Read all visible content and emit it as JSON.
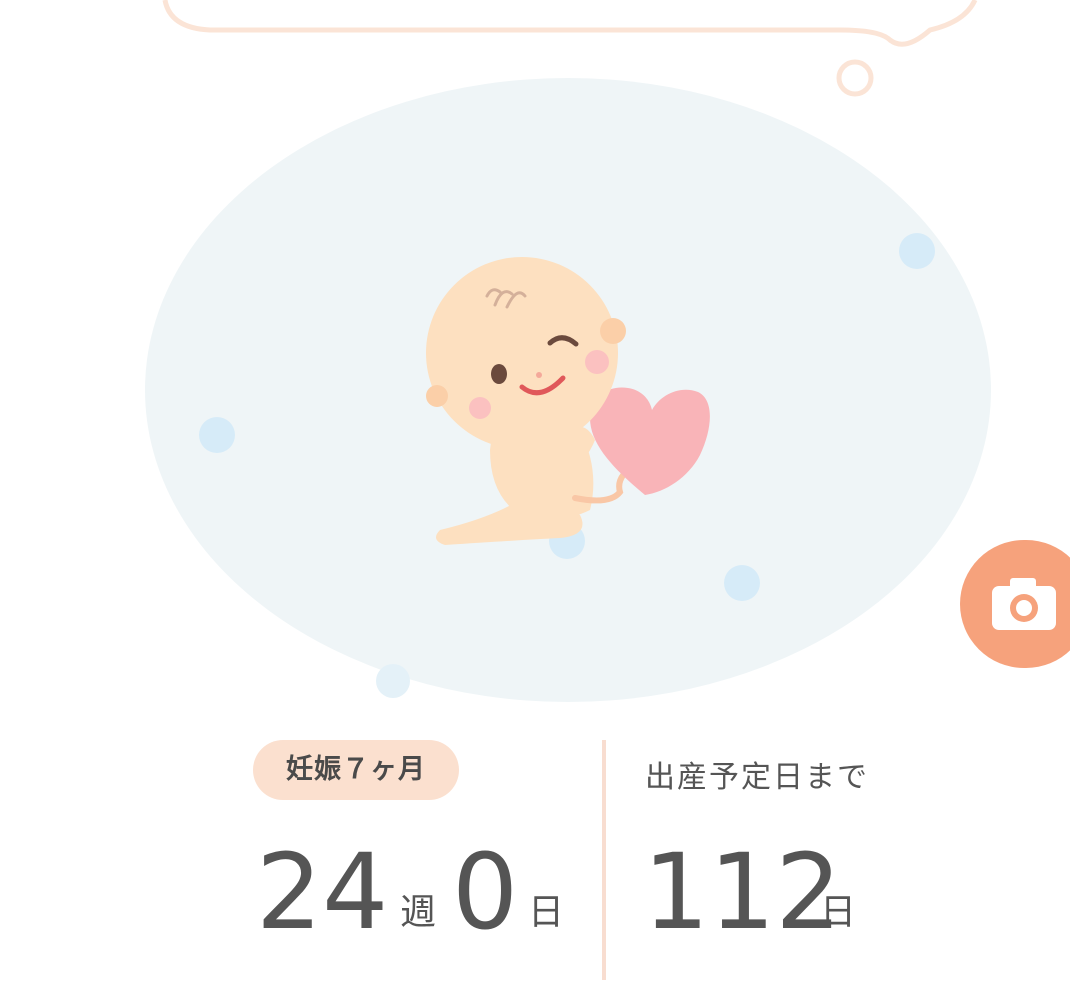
{
  "pregnancy_month_badge": "妊娠７ヶ月",
  "due_date_label": "出産予定日まで",
  "weeks_value": "24",
  "weeks_unit": "週",
  "days_value": "0",
  "days_unit": "日",
  "days_until_due_value": "112",
  "days_until_due_unit": "日",
  "icons": {
    "camera": "camera-icon",
    "illustration": "baby-heart-illustration"
  },
  "colors": {
    "badge_bg": "#fbe0cf",
    "accent_orange": "#f6a27c",
    "womb_bg": "#eff5f7",
    "bubble_blue": "#d6ebf8",
    "divider": "#f8ddd0"
  }
}
